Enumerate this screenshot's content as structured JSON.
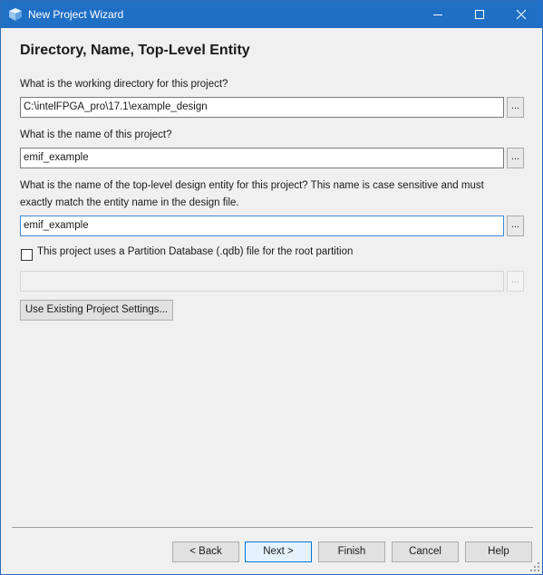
{
  "window": {
    "title": "New Project Wizard",
    "icon": "quartus-app-icon",
    "controls": [
      "minimize-icon",
      "maximize-icon",
      "close-icon"
    ]
  },
  "page": {
    "title": "Directory, Name, Top-Level Entity"
  },
  "fields": {
    "working_dir": {
      "label": "What is the working directory for this project?",
      "value": "C:\\intelFPGA_pro\\17.1\\example_design",
      "browse_label": "..."
    },
    "project_name": {
      "label": "What is the name of this project?",
      "value": "emif_example",
      "browse_label": "..."
    },
    "top_level": {
      "label": "What is the name of the top-level design entity for this project? This name is case sensitive and must exactly match the entity name in the design file.",
      "value": "emif_example",
      "browse_label": "..."
    },
    "partition_db": {
      "checkbox_label": "This project uses a Partition Database (.qdb) file for the root partition",
      "checked": false,
      "value": "",
      "browse_label": "..."
    }
  },
  "buttons": {
    "use_existing": "Use Existing Project Settings...",
    "back": "< Back",
    "next": "Next >",
    "finish": "Finish",
    "cancel": "Cancel",
    "help": "Help"
  }
}
